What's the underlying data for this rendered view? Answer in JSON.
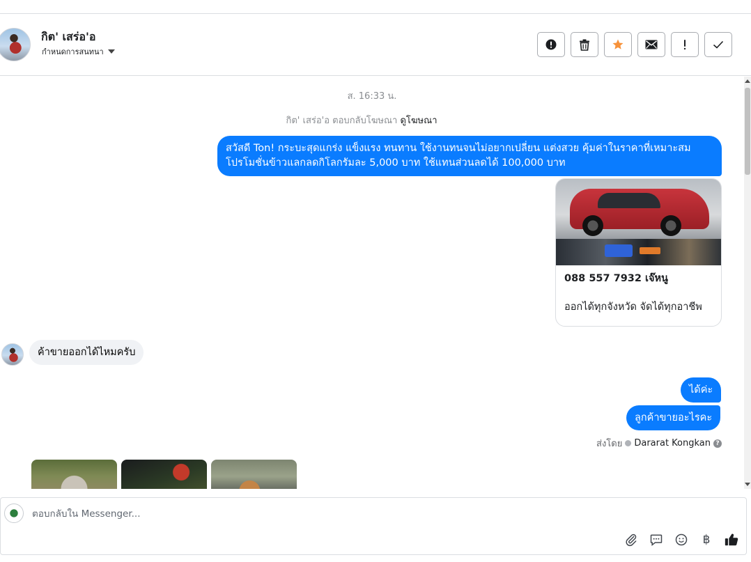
{
  "header": {
    "contact_name": "กิต' เสร่อ'อ",
    "assign_label": "กำหนดการสนทนา",
    "actions": [
      {
        "name": "spam-button",
        "icon": "alert-circle-icon"
      },
      {
        "name": "delete-button",
        "icon": "trash-icon"
      },
      {
        "name": "follow-up-button",
        "icon": "star-icon"
      },
      {
        "name": "mark-unread-button",
        "icon": "envelope-icon"
      },
      {
        "name": "priority-button",
        "icon": "exclamation-icon"
      },
      {
        "name": "mark-done-button",
        "icon": "check-icon"
      }
    ],
    "star_color": "#f7923a"
  },
  "thread": {
    "timestamp": "ส. 16:33 น.",
    "ad_reply_prefix": "กิต' เสร่อ'อ ตอบกลับโฆษณา",
    "ad_reply_link": "ดูโฆษณา",
    "messages": [
      {
        "direction": "outgoing",
        "lines": [
          "สวัสดี Ton! กระบะสุดแกร่ง แข็งแรง ทนทาน ใช้งานทนจนไม่อยากเปลี่ยน แต่งสวย คุ้มค่าในราคาที่เหมาะสม",
          "โปรโมชั่นข้าวแลกลดกิโลกรัมละ 5,000 บาท ใช้แทนส่วนลดได้ 100,000 บาท"
        ]
      },
      {
        "direction": "outgoing",
        "type": "card",
        "title": "088 557 7932 เจ๊หนู",
        "subtitle": "ออกได้ทุกจังหวัด จัดได้ทุกอาชีพ"
      },
      {
        "direction": "incoming",
        "text": "ค้าขายออกได้ไหมครับ"
      },
      {
        "direction": "outgoing",
        "text": "ได้ค่ะ"
      },
      {
        "direction": "outgoing",
        "text": "ลูกค้าขายอะไรคะ"
      }
    ],
    "sent_by_label": "ส่งโดย",
    "sent_by_name": "Dararat Kongkan",
    "bubble_color": "#0a7cff"
  },
  "composer": {
    "placeholder": "ตอบกลับใน Messenger...",
    "tools": [
      "paperclip-icon",
      "saved-replies-icon",
      "emoji-icon",
      "baht-icon",
      "thumbs-up-icon"
    ],
    "baht_symbol": "฿"
  }
}
